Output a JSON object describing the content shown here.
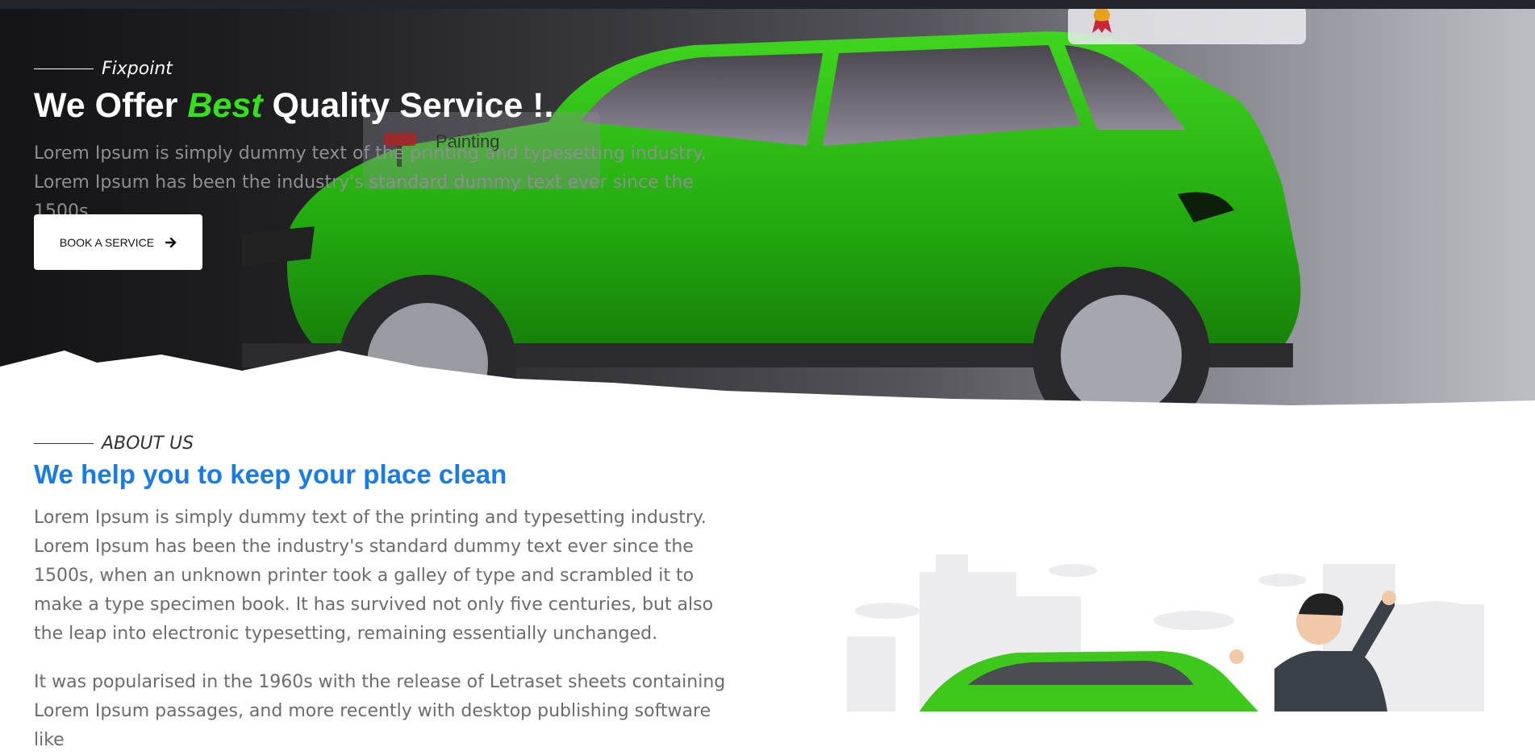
{
  "hero": {
    "tagline": "Fixpoint",
    "title_pre": "We Offer ",
    "title_highlight": "Best",
    "title_post": " Quality Service !.",
    "desc_line1": "Lorem Ipsum is simply dummy text of the printing and typesetting industry.",
    "desc_line2": "Lorem Ipsum has been the industry's standard dummy text ever since the 1500s.",
    "ghost_card_label": "Painting",
    "button_label": "BOOK A SERVICE"
  },
  "about": {
    "tagline": "ABOUT US",
    "title": "We help you to keep your place clean",
    "paragraph1": "Lorem Ipsum is simply dummy text of the printing and typesetting industry. Lorem Ipsum has been the industry's standard dummy text ever since the 1500s, when an unknown printer took a galley of type and scrambled it to make a type specimen book. It has survived not only five centuries, but also the leap into electronic typesetting, remaining essentially unchanged.",
    "paragraph2": "It was popularised in the 1960s with the release of Letraset sheets containing Lorem Ipsum passages, and more recently with desktop publishing software like"
  },
  "colors": {
    "accent_green": "#34e11b",
    "accent_blue": "#1a7be8",
    "car_green": "#2fbf14",
    "dark_bg": "#141416"
  },
  "icons": [
    "arrow-right-icon",
    "award-ribbon-icon",
    "paint-roller-icon"
  ]
}
